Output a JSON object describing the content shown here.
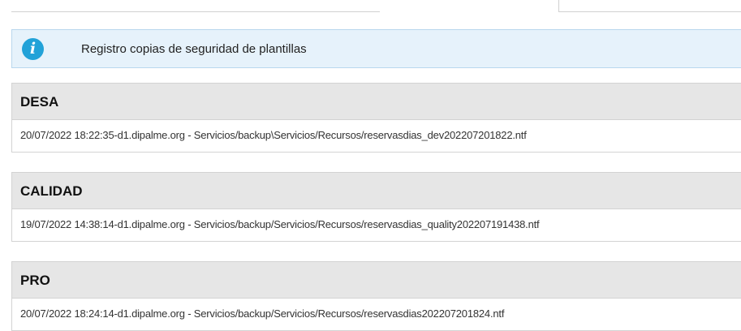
{
  "info": {
    "icon": "info-icon",
    "icon_glyph": "i",
    "message": "Registro copias de seguridad de plantillas"
  },
  "sections": [
    {
      "title": "DESA",
      "entry": "20/07/2022 18:22:35-d1.dipalme.org - Servicios/backup\\Servicios/Recursos/reservasdias_dev202207201822.ntf"
    },
    {
      "title": "CALIDAD",
      "entry": "19/07/2022 14:38:14-d1.dipalme.org - Servicios/backup/Servicios/Recursos/reservasdias_quality202207191438.ntf"
    },
    {
      "title": "PRO",
      "entry": "20/07/2022 18:24:14-d1.dipalme.org - Servicios/backup/Servicios/Recursos/reservasdias202207201824.ntf"
    }
  ],
  "colors": {
    "info_background": "#e6f2fb",
    "info_icon": "#22a2d8",
    "section_header": "#e6e6e6"
  }
}
